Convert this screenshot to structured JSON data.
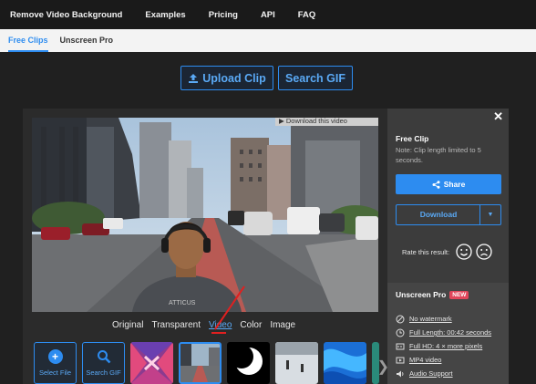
{
  "nav": {
    "items": [
      "Remove Video Background",
      "Examples",
      "Pricing",
      "API",
      "FAQ"
    ]
  },
  "subnav": {
    "items": [
      "Free Clips",
      "Unscreen Pro"
    ],
    "active": "Free Clips"
  },
  "actions": {
    "upload_label": "Upload Clip",
    "search_label": "Search GIF"
  },
  "preview": {
    "download_banner": "Download this video",
    "watermark_text": "ATTICUS"
  },
  "view_tabs": {
    "items": [
      "Original",
      "Transparent",
      "Video",
      "Color",
      "Image"
    ],
    "active": "Video"
  },
  "thumbnails": {
    "select_file_label": "Select File",
    "search_gif_label": "Search GIF"
  },
  "sidebar": {
    "title": "Free Clip",
    "note": "Note: Clip length limited to 5 seconds.",
    "share_label": "Share",
    "download_label": "Download",
    "rate_label": "Rate this result:",
    "pro_title": "Unscreen Pro",
    "new_badge": "NEW",
    "features": [
      {
        "icon": "no-watermark-icon",
        "label": "No watermark"
      },
      {
        "icon": "clock-icon",
        "label": "Full Length: 00:42 seconds"
      },
      {
        "icon": "hd-icon",
        "label": "Full HD: 4 × more pixels"
      },
      {
        "icon": "video-icon",
        "label": "MP4 video"
      },
      {
        "icon": "audio-icon",
        "label": "Audio Support"
      }
    ]
  },
  "colors": {
    "accent": "#2d8cf0",
    "badge": "#e0465b",
    "road_lane": "#b85a54"
  }
}
